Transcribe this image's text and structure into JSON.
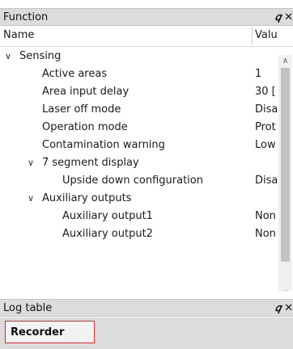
{
  "function_panel": {
    "title": "Function",
    "pin_icon": "pin-icon",
    "close_icon": "close-icon",
    "columns": {
      "name": "Name",
      "value": "Valu"
    },
    "rows": [
      {
        "label": "Sensing",
        "value": "",
        "expanded": true
      },
      {
        "label": "Active areas",
        "value": "1"
      },
      {
        "label": "Area input delay",
        "value": "30 ["
      },
      {
        "label": "Laser off mode",
        "value": "Disa"
      },
      {
        "label": "Operation mode",
        "value": "Prot"
      },
      {
        "label": "Contamination warning",
        "value": "Low"
      },
      {
        "label": "7 segment display",
        "value": "",
        "expanded": true
      },
      {
        "label": "Upside down configuration",
        "value": "Disa"
      },
      {
        "label": "Auxiliary outputs",
        "value": "",
        "expanded": true
      },
      {
        "label": "Auxiliary output1",
        "value": "Non"
      },
      {
        "label": "Auxiliary output2",
        "value": "Non"
      }
    ]
  },
  "log_panel": {
    "title": "Log table",
    "pin_icon": "pin-icon",
    "close_icon": "close-icon"
  },
  "bottom_tabs": {
    "recorder_label": "Recorder",
    "highlight_color": "#e2262a"
  }
}
